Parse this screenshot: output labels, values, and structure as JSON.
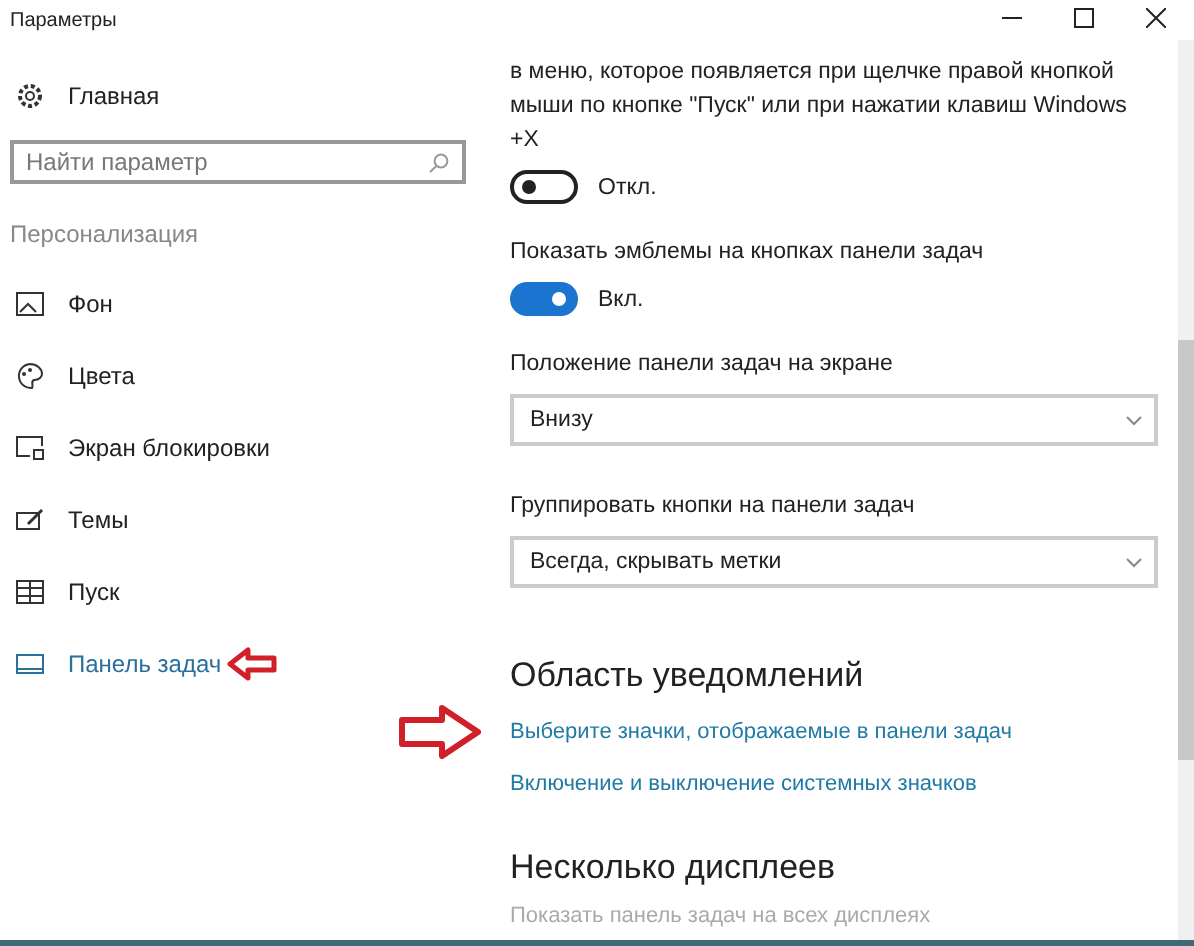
{
  "window": {
    "title": "Параметры"
  },
  "sidebar": {
    "home": "Главная",
    "search": {
      "placeholder": "Найти параметр"
    },
    "section": "Персонализация",
    "items": [
      {
        "label": "Фон",
        "kind": "background",
        "selected": false
      },
      {
        "label": "Цвета",
        "kind": "colors",
        "selected": false
      },
      {
        "label": "Экран блокировки",
        "kind": "lock",
        "selected": false
      },
      {
        "label": "Темы",
        "kind": "themes",
        "selected": false
      },
      {
        "label": "Пуск",
        "kind": "start",
        "selected": false
      },
      {
        "label": "Панель задач",
        "kind": "taskbar",
        "selected": true
      }
    ]
  },
  "content": [
    {
      "kind": "text",
      "text": "в меню, которое появляется при щелчке правой кнопкой мыши по кнопке \"Пуск\" или при нажатии клавиш Windows +X"
    },
    {
      "kind": "toggle",
      "on": false,
      "state": "Откл."
    },
    {
      "kind": "text",
      "text": "Показать эмблемы на кнопках панели задач"
    },
    {
      "kind": "toggle",
      "on": true,
      "state": "Вкл."
    },
    {
      "kind": "text",
      "text": "Положение панели задач на экране"
    },
    {
      "kind": "dropdown",
      "value": "Внизу"
    },
    {
      "kind": "text",
      "text": "Группировать кнопки на панели задач"
    },
    {
      "kind": "dropdown",
      "value": "Всегда, скрывать метки"
    },
    {
      "kind": "heading",
      "text": "Область уведомлений"
    },
    {
      "kind": "link",
      "text": "Выберите значки, отображаемые в панели задач"
    },
    {
      "kind": "link",
      "text": "Включение и выключение системных значков"
    },
    {
      "kind": "heading",
      "text": "Несколько дисплеев"
    },
    {
      "kind": "disabled",
      "text": "Показать панель задач на всех дисплеях"
    }
  ]
}
